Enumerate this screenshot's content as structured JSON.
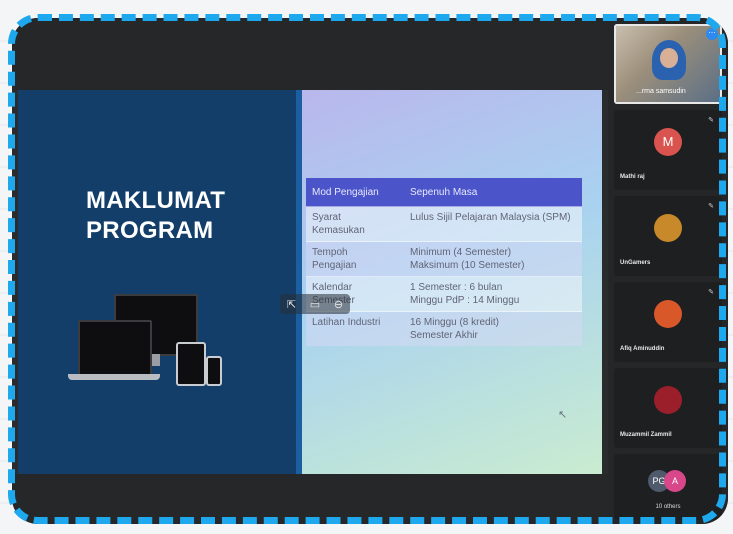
{
  "slide": {
    "title_line1": "MAKLUMAT",
    "title_line2": "PROGRAM",
    "table": {
      "header": [
        "Mod Pengajian",
        "Sepenuh Masa"
      ],
      "rows": [
        {
          "label": [
            "Syarat",
            "Kemasukan"
          ],
          "value": [
            "Lulus Sijil Pelajaran Malaysia (SPM)"
          ]
        },
        {
          "label": [
            "Tempoh",
            "Pengajian"
          ],
          "value": [
            "Minimum (4 Semester)",
            "Maksimum (10 Semester)"
          ]
        },
        {
          "label": [
            "Kalendar",
            "Semester"
          ],
          "value": [
            "1 Semester : 6 bulan",
            "Minggu PdP : 14 Minggu"
          ]
        },
        {
          "label": [
            "Latihan Industri"
          ],
          "value": [
            "16 Minggu (8 kredit)",
            "Semester Akhir"
          ]
        }
      ]
    }
  },
  "participants": [
    {
      "name": "...rma samsudin",
      "initial": "",
      "color": "#2a62b0",
      "active": true
    },
    {
      "name": "Mathi raj",
      "initial": "M",
      "color": "#d9534f"
    },
    {
      "name": "UnGamers",
      "initial": "",
      "color": "#c8892a"
    },
    {
      "name": "Afiq Aminuddin",
      "initial": "",
      "color": "#d8582a"
    },
    {
      "name": "Muzammil Zammil",
      "initial": "",
      "color": "#9b1f2a"
    }
  ],
  "others": {
    "initials": [
      "PG",
      "A"
    ],
    "label": "10 others"
  },
  "colors": {
    "accent_frame": "#1ea8ee",
    "slide_dark": "#133e6a",
    "table_header": "#4b55c9"
  }
}
